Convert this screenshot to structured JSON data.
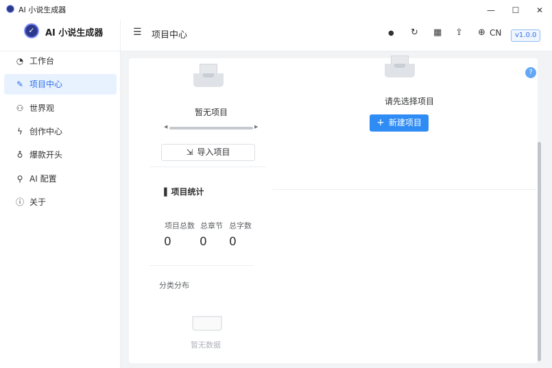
{
  "window": {
    "title": "AI 小说生成器",
    "controls": {
      "minimize": "—",
      "maximize": "☐",
      "close": "✕"
    }
  },
  "sidebar": {
    "logo_text": "AI 小说生成器",
    "logo_glyph": "✓",
    "items": [
      {
        "label": "工作台",
        "icon": "dashboard-icon",
        "glyph": "◔",
        "active": false
      },
      {
        "label": "项目中心",
        "icon": "edit-icon",
        "glyph": "✎",
        "active": true
      },
      {
        "label": "世界观",
        "icon": "people-icon",
        "glyph": "⚇",
        "active": false
      },
      {
        "label": "创作中心",
        "icon": "lightning-icon",
        "glyph": "ϟ",
        "active": false
      },
      {
        "label": "爆款开头",
        "icon": "drop-icon",
        "glyph": "♁",
        "active": false
      },
      {
        "label": "AI 配置",
        "icon": "plug-icon",
        "glyph": "⚲",
        "active": false
      },
      {
        "label": "关于",
        "icon": "info-icon",
        "glyph": "ⓘ",
        "active": false
      }
    ]
  },
  "header": {
    "menu_glyph": "☰",
    "title": "项目中心",
    "icons": [
      {
        "name": "bulb-icon",
        "glyph": "●"
      },
      {
        "name": "refresh-icon",
        "glyph": "↻"
      },
      {
        "name": "grid-icon",
        "glyph": "▦"
      },
      {
        "name": "upload-cloud-icon",
        "glyph": "⇪"
      },
      {
        "name": "globe-icon",
        "glyph": "⊕"
      }
    ],
    "language": "CN",
    "version": "v1.0.0"
  },
  "left_panel": {
    "empty_text": "暂无项目",
    "import_label": "导入项目",
    "import_glyph": "⇲",
    "stats_glyph": "▐",
    "stats_title": "项目统计",
    "stats": [
      {
        "label": "项目总数",
        "value": "0"
      },
      {
        "label": "总章节",
        "value": "0"
      },
      {
        "label": "总字数",
        "value": "0"
      }
    ],
    "distribution_title": "分类分布",
    "no_data_text": "暂无数据"
  },
  "right_panel": {
    "empty_text": "请先选择项目",
    "new_label": "新建项目",
    "new_glyph": "+"
  },
  "help_glyph": "?",
  "colors": {
    "accent": "#2f8cf5",
    "active_bg": "#e8f2ff",
    "active_text": "#2f6ee8",
    "content_bg": "#f2f3f5"
  }
}
